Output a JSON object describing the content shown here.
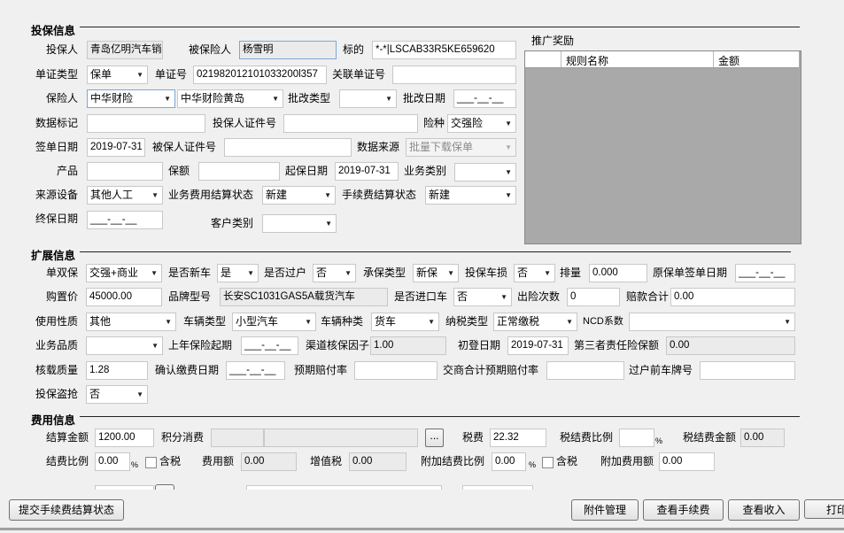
{
  "policy": {
    "title": "投保信息",
    "applicant_label": "投保人",
    "applicant": "青岛亿明汽车销售用",
    "insured_label": "被保险人",
    "insured": "杨雪明",
    "subject_label": "标的",
    "subject": "*-*|LSCAB33R5KE659620",
    "doc_type_label": "单证类型",
    "doc_type": "保单",
    "doc_no_label": "单证号",
    "doc_no": "021982012101033200l357",
    "related_doc_label": "关联单证号",
    "related_doc": "",
    "insurer_label": "保险人",
    "insurer": "中华财险",
    "insurer_branch": "中华财险黄岛",
    "endorse_type_label": "批改类型",
    "endorse_type": "",
    "endorse_date_label": "批改日期",
    "endorse_date": "___-__-__",
    "data_mark_label": "数据标记",
    "data_mark": "",
    "applicant_id_label": "投保人证件号",
    "applicant_id": "",
    "risk_label": "险种",
    "risk": "交强险",
    "sign_date_label": "签单日期",
    "sign_date": "2019-07-31",
    "insured_id_label": "被保人证件号",
    "insured_id": "",
    "data_source_label": "数据来源",
    "data_source": "批量下载保单",
    "product_label": "产品",
    "product": "",
    "amount_label": "保额",
    "amount": "",
    "start_date_label": "起保日期",
    "start_date": "2019-07-31",
    "biz_category_label": "业务类别",
    "biz_category": "",
    "source_device_label": "来源设备",
    "source_device": "其他人工",
    "fee_settle_label": "业务费用结算状态",
    "fee_settle": "新建",
    "commission_settle_label": "手续费结算状态",
    "commission_settle": "新建",
    "end_date_label": "终保日期",
    "end_date": "___-__-__",
    "customer_type_label": "客户类别",
    "customer_type": ""
  },
  "promo": {
    "title": "推广奖励",
    "col_rule": "规则名称",
    "col_amount": "金额"
  },
  "ext": {
    "title": "扩展信息",
    "single_double_label": "单双保",
    "single_double": "交强+商业",
    "new_car_label": "是否新车",
    "new_car": "是",
    "transfer_label": "是否过户",
    "transfer": "否",
    "underwrite_type_label": "承保类型",
    "underwrite_type": "新保",
    "damage_label": "投保车损",
    "damage": "否",
    "displacement_label": "排量",
    "displacement": "0.000",
    "orig_sign_date_label": "原保单签单日期",
    "orig_sign_date": "___-__-__",
    "price_label": "购置价",
    "price": "45000.00",
    "model_label": "品牌型号",
    "model": "长安SC1031GAS5A载货汽车",
    "imported_label": "是否进口车",
    "imported": "否",
    "claims_count_label": "出险次数",
    "claims_count": "0",
    "claims_total_label": "赔款合计",
    "claims_total": "0.00",
    "usage_label": "使用性质",
    "usage": "其他",
    "vehicle_type_label": "车辆类型",
    "vehicle_type": "小型汽车",
    "vehicle_kind_label": "车辆种类",
    "vehicle_kind": "货车",
    "tax_type_label": "纳税类型",
    "tax_type": "正常缴税",
    "ncd_label": "NCD系数",
    "ncd": "",
    "quality_label": "业务品质",
    "quality": "",
    "last_start_label": "上年保险起期",
    "last_start": "___-__-__",
    "channel_factor_label": "渠道核保因子",
    "channel_factor": "1.00",
    "first_reg_label": "初登日期",
    "first_reg": "2019-07-31",
    "third_party_label": "第三者责任险保额",
    "third_party": "0.00",
    "load_label": "核载质量",
    "load": "1.28",
    "pay_confirm_label": "确认缴费日期",
    "pay_confirm": "___-__-__",
    "expected_ratio_label": "预期赔付率",
    "expected_ratio": "",
    "combined_ratio_label": "交商合计预期赔付率",
    "combined_ratio": "",
    "prev_plate_label": "过户前车牌号",
    "prev_plate": "",
    "theft_label": "投保盗抢",
    "theft": "否"
  },
  "fee": {
    "title": "费用信息",
    "settle_amount_label": "结算金额",
    "settle_amount": "1200.00",
    "points_label": "积分消费",
    "points": "",
    "points2": "",
    "browse": "...",
    "tax_label": "税费",
    "tax": "22.32",
    "tax_ratio_label": "税结费比例",
    "tax_ratio": "",
    "pct": "%",
    "tax_amount_label": "税结费金额",
    "tax_amount": "0.00",
    "ratio_label": "结费比例",
    "ratio": "0.00",
    "incl_tax": "含税",
    "fee_amount_label": "费用额",
    "fee_amount": "0.00",
    "vat_label": "增值税",
    "vat": "0.00",
    "extra_ratio_label": "附加结费比例",
    "extra_ratio": "0.00",
    "extra_amount_label": "附加费用额",
    "extra_amount": "0.00"
  },
  "buttons": {
    "submit": "提交手续费结算状态",
    "attachments": "附件管理",
    "view_commission": "查看手续费",
    "view_income": "查看收入",
    "print": "打印"
  }
}
